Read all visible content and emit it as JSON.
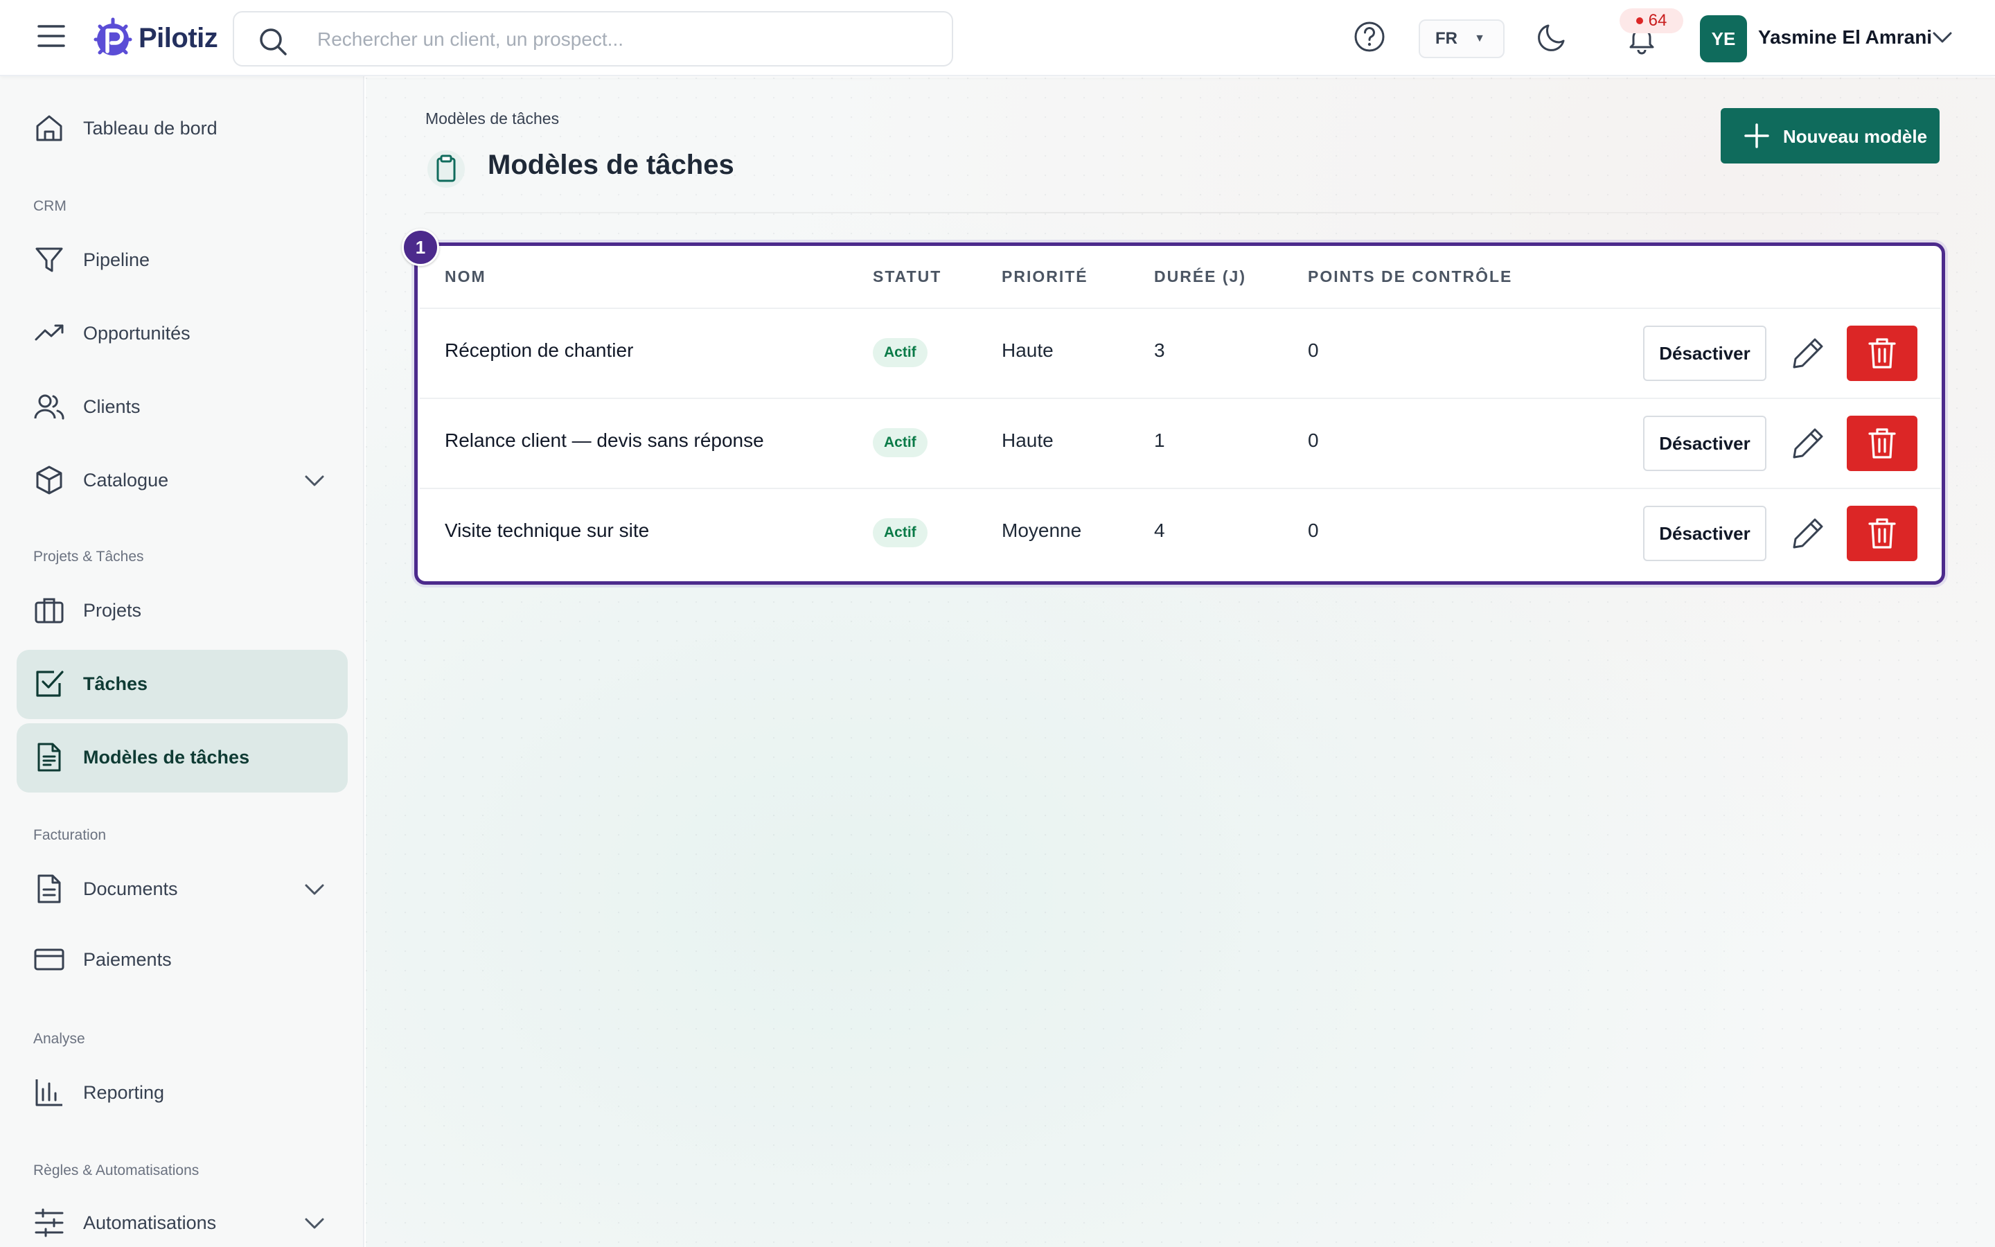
{
  "app": {
    "name": "Pilotiz"
  },
  "search": {
    "placeholder": "Rechercher un client, un prospect..."
  },
  "header": {
    "language": "FR",
    "notifications_count": "64",
    "user": {
      "initials": "YE",
      "name": "Yasmine El Amrani"
    }
  },
  "colors": {
    "brand": "#0f6b5c",
    "highlight": "#4c2a8c",
    "danger": "#dc2626",
    "success_badge": "#e4f4ec"
  },
  "sidebar": {
    "dashboard": "Tableau de bord",
    "sections": {
      "crm": "CRM",
      "projects": "Projets & Tâches",
      "billing": "Facturation",
      "analysis": "Analyse",
      "rules": "Règles & Automatisations"
    },
    "items": {
      "pipeline": "Pipeline",
      "opportunities": "Opportunités",
      "clients": "Clients",
      "catalogue": "Catalogue",
      "projects": "Projets",
      "tasks": "Tâches",
      "task_templates": "Modèles de tâches",
      "documents": "Documents",
      "payments": "Paiements",
      "reporting": "Reporting",
      "automations": "Automatisations"
    }
  },
  "page": {
    "breadcrumb": "Modèles de tâches",
    "title": "Modèles de tâches",
    "new_button": "Nouveau modèle",
    "marker": "1"
  },
  "table": {
    "columns": {
      "name": "NOM",
      "status": "STATUT",
      "priority": "PRIORITÉ",
      "duration": "DURÉE (J)",
      "checkpoints": "POINTS DE CONTRÔLE"
    },
    "rows": [
      {
        "name": "Réception de chantier",
        "status": "Actif",
        "priority": "Haute",
        "duration": "3",
        "checkpoints": "0",
        "action": "Désactiver"
      },
      {
        "name": "Relance client — devis sans réponse",
        "status": "Actif",
        "priority": "Haute",
        "duration": "1",
        "checkpoints": "0",
        "action": "Désactiver"
      },
      {
        "name": "Visite technique sur site",
        "status": "Actif",
        "priority": "Moyenne",
        "duration": "4",
        "checkpoints": "0",
        "action": "Désactiver"
      }
    ]
  }
}
